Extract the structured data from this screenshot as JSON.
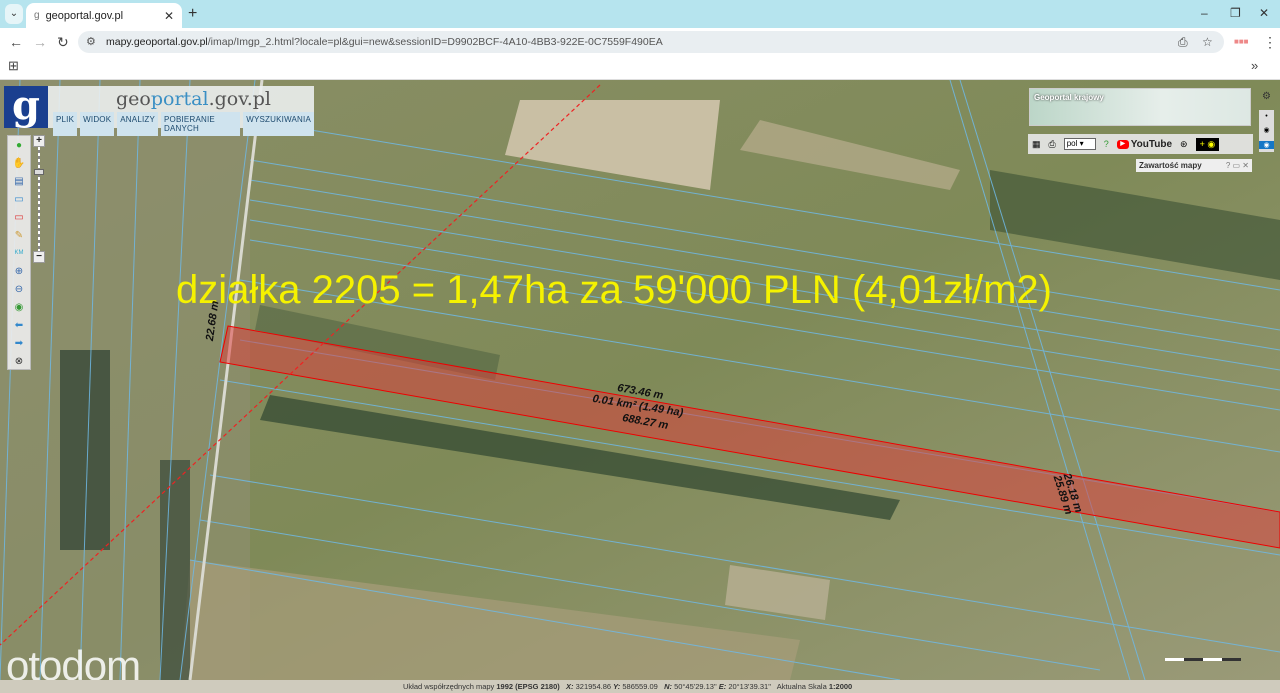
{
  "browser": {
    "tab_title": "geoportal.gov.pl",
    "url_host": "mapy.geoportal.gov.pl",
    "url_path": "/imap/Imgp_2.html?locale=pl&gui=new&sessionID=D9902BCF-4A10-4BB3-922E-0C7559F490EA"
  },
  "geoportal": {
    "logo_letter": "g",
    "brand_pre": "geo",
    "brand_mid": "portal",
    "brand_post": ".gov.pl",
    "menu": [
      "PLIK",
      "WIDOK",
      "ANALIZY",
      "POBIERANIE DANYCH",
      "WYSZUKIWANIA"
    ],
    "minimap_title": "Geoportal krajowy",
    "language": "pol",
    "youtube": "YouTube",
    "map_content": "Zawartość mapy"
  },
  "map": {
    "headline": "działka 2205 = 1,47ha za 59'000 PLN (4,01zł/m2)",
    "label_left": "22.68 m",
    "label_top": "673.46 m",
    "label_area": "0.01 km² (1.49 ha)",
    "label_bottom": "688.27 m",
    "label_right1": "26.18 m",
    "label_right2": "25.89 m",
    "watermark": "otodom"
  },
  "status": {
    "system_label": "Układ współrzędnych mapy",
    "system": "1992 (EPSG 2180)",
    "x_label": "X:",
    "x": "321954.86",
    "y_label": "Y:",
    "y": "586559.09",
    "n_label": "N:",
    "n": "50°45'29.13\"",
    "e_label": "E:",
    "e": "20°13'39.31\"",
    "scale_label": "Aktualna Skala",
    "scale": "1:2000"
  }
}
